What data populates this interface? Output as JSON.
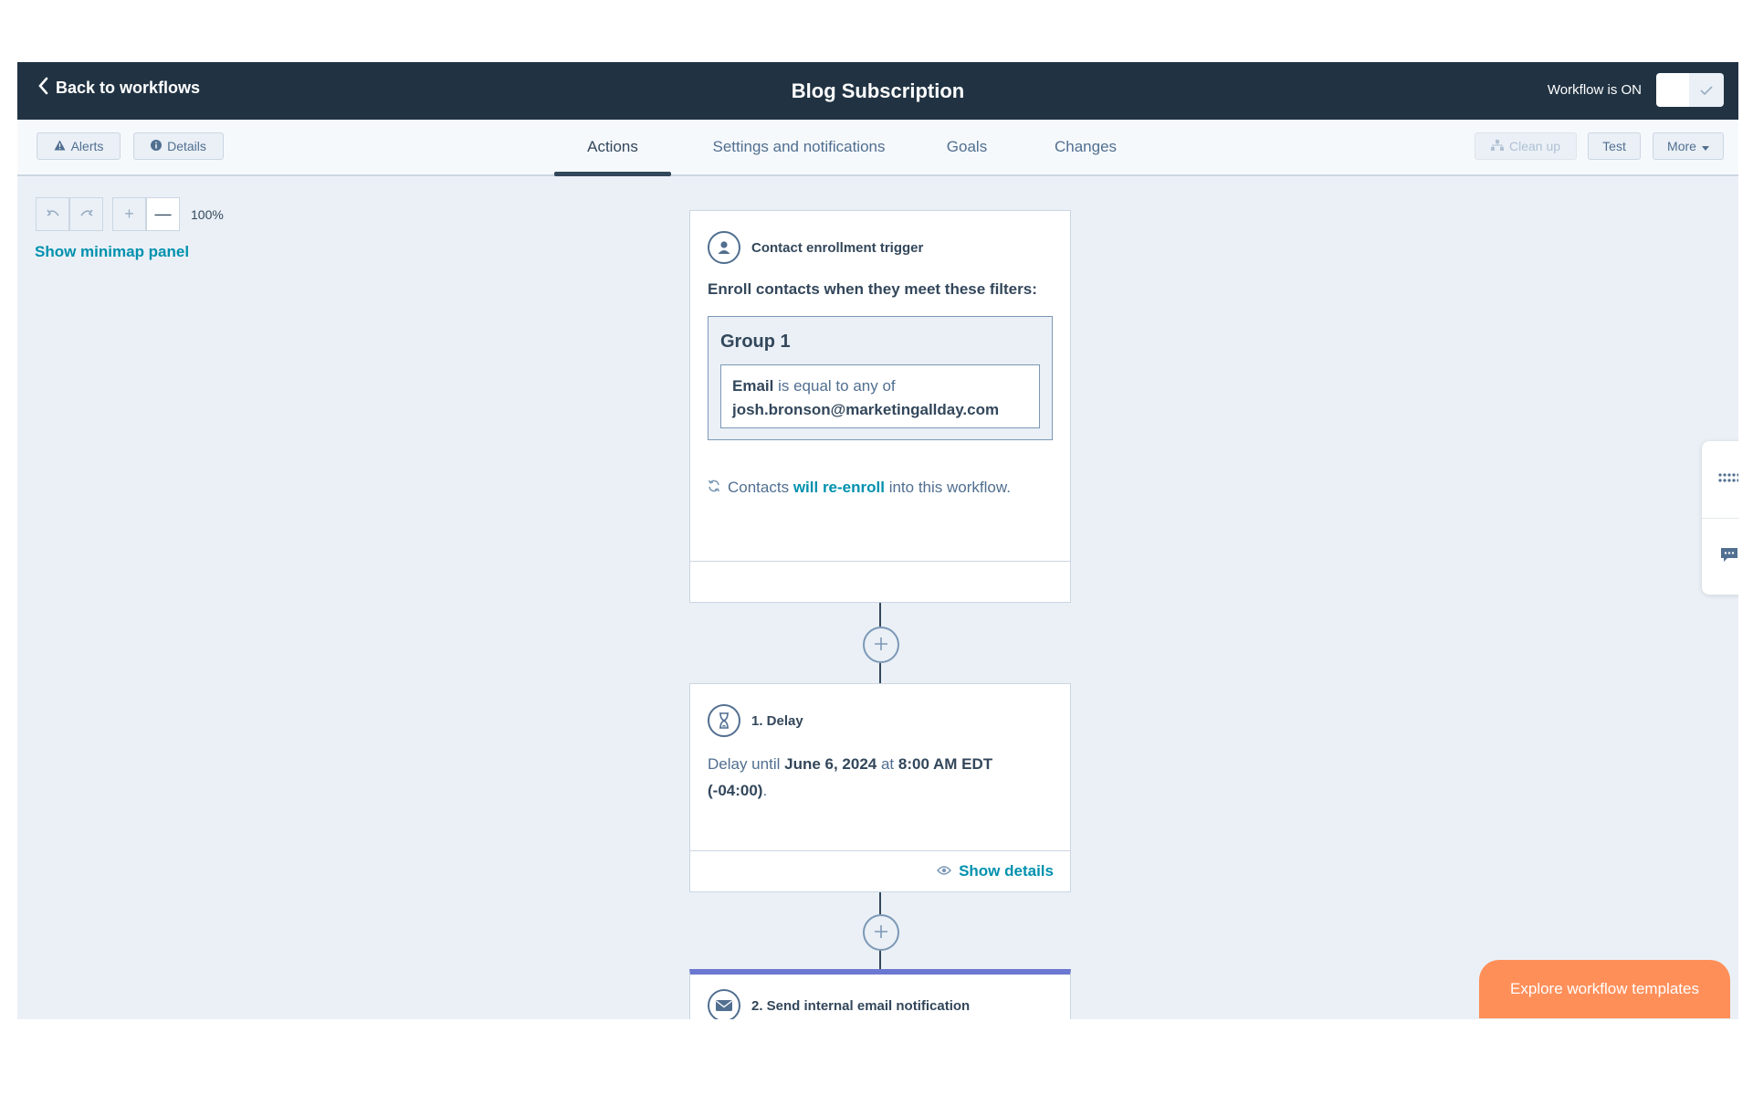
{
  "header": {
    "back_label": "Back to workflows",
    "title": "Blog Subscription",
    "status_label": "Workflow is ON"
  },
  "toolbar": {
    "alerts_label": "Alerts",
    "details_label": "Details",
    "cleanup_label": "Clean up",
    "test_label": "Test",
    "more_label": "More"
  },
  "tabs": [
    {
      "label": "Actions",
      "active": true
    },
    {
      "label": "Settings and notifications",
      "active": false
    },
    {
      "label": "Goals",
      "active": false
    },
    {
      "label": "Changes",
      "active": false
    }
  ],
  "canvas": {
    "zoom_level": "100%",
    "minimap_label": "Show minimap panel"
  },
  "trigger": {
    "title": "Contact enrollment trigger",
    "intro": "Enroll contacts when they meet these filters:",
    "group_title": "Group 1",
    "filter_property": "Email",
    "filter_operator": "is equal to any of",
    "filter_value": "josh.bronson@marketingallday.com",
    "reenroll_prefix": "Contacts",
    "reenroll_link": "will re-enroll",
    "reenroll_suffix": "into this workflow."
  },
  "delay": {
    "title": "1. Delay",
    "prefix": "Delay until",
    "date": "June 6, 2024",
    "at": "at",
    "time": "8:00 AM EDT (-04:00)",
    "suffix": ".",
    "show_details": "Show details"
  },
  "email_action": {
    "title": "2. Send internal email notification"
  },
  "explore_label": "Explore workflow templates",
  "colors": {
    "header_bg": "#213343",
    "accent_link": "#0091ae",
    "explore_button": "#ff8f59",
    "email_action_bar": "#6a78d1"
  }
}
